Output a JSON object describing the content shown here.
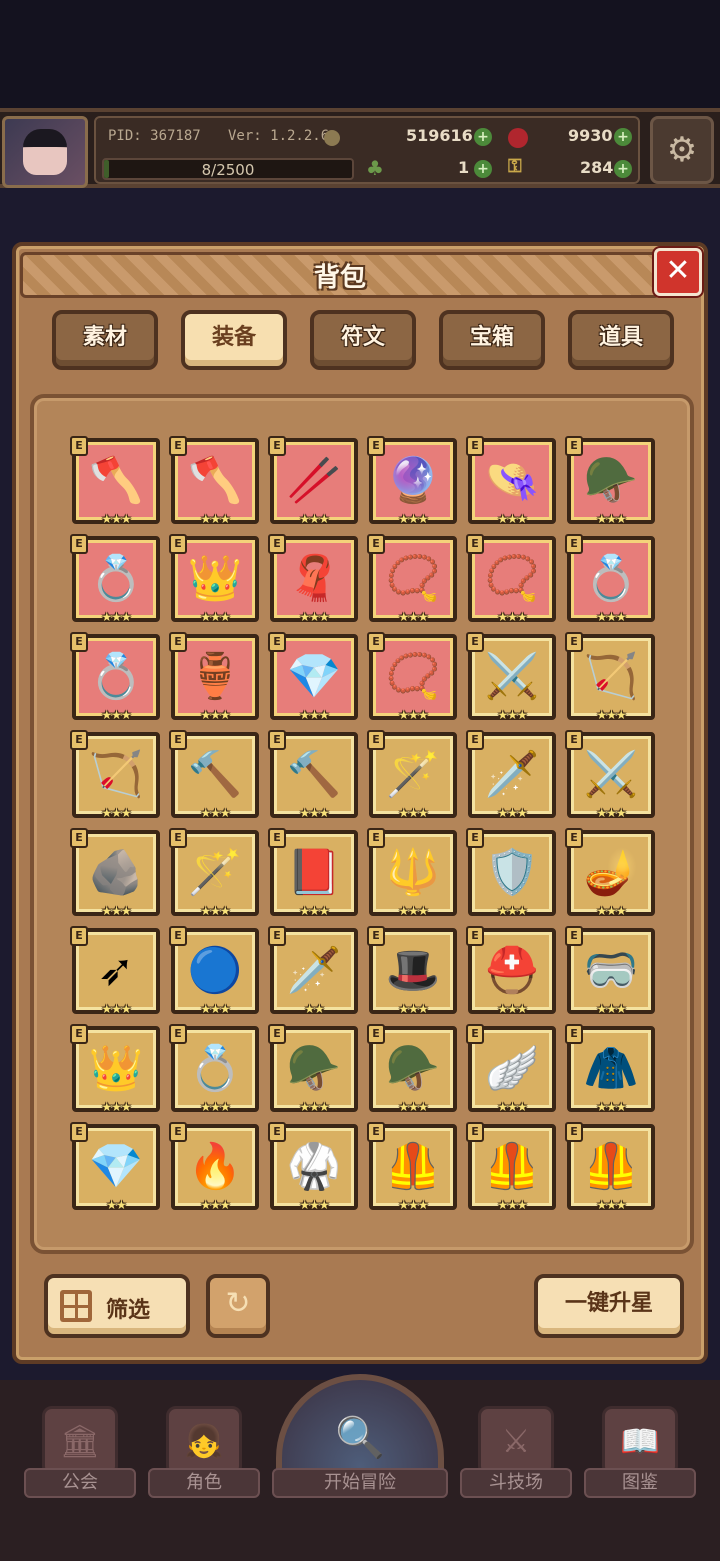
{
  "header": {
    "pid": "PID: 367187",
    "version": "Ver: 1.2.2.6",
    "exp": "8/2500",
    "gold": "519616",
    "gems": "9930",
    "clover": "1",
    "keys": "284",
    "settings_icon": "gear-icon"
  },
  "bag": {
    "title": "背包",
    "close_icon": "close-icon",
    "tabs": [
      {
        "label": "素材",
        "active": false
      },
      {
        "label": "装备",
        "active": true
      },
      {
        "label": "符文",
        "active": false
      },
      {
        "label": "宝箱",
        "active": false
      },
      {
        "label": "道具",
        "active": false
      }
    ],
    "badge": "E",
    "items": [
      {
        "icon": "double-axe-icon",
        "glyph": "🪓",
        "bg": "red",
        "stars": 3
      },
      {
        "icon": "battle-axe-icon",
        "glyph": "🪓",
        "bg": "red",
        "stars": 3
      },
      {
        "icon": "staff-icon",
        "glyph": "🥢",
        "bg": "red",
        "stars": 3
      },
      {
        "icon": "dark-orb-icon",
        "glyph": "🔮",
        "bg": "red",
        "stars": 3
      },
      {
        "icon": "straw-hat-icon",
        "glyph": "👒",
        "bg": "red",
        "stars": 3
      },
      {
        "icon": "crystal-helm-icon",
        "glyph": "🪖",
        "bg": "red",
        "stars": 3
      },
      {
        "icon": "fire-ring-icon",
        "glyph": "💍",
        "bg": "red",
        "stars": 3
      },
      {
        "icon": "horned-crown-icon",
        "glyph": "👑",
        "bg": "red",
        "stars": 3
      },
      {
        "icon": "red-cloak-icon",
        "glyph": "🧣",
        "bg": "red",
        "stars": 3
      },
      {
        "icon": "gold-amulet-icon",
        "glyph": "📿",
        "bg": "red",
        "stars": 3
      },
      {
        "icon": "pendant-icon",
        "glyph": "📿",
        "bg": "red",
        "stars": 3
      },
      {
        "icon": "jewel-ring-icon",
        "glyph": "💍",
        "bg": "red",
        "stars": 3
      },
      {
        "icon": "gold-ring-icon",
        "glyph": "💍",
        "bg": "red",
        "stars": 3
      },
      {
        "icon": "vase-icon",
        "glyph": "🏺",
        "bg": "red",
        "stars": 3
      },
      {
        "icon": "gem-brooch-icon",
        "glyph": "💎",
        "bg": "red",
        "stars": 3
      },
      {
        "icon": "silver-necklace-icon",
        "glyph": "📿",
        "bg": "red",
        "stars": 3
      },
      {
        "icon": "crossed-swords-icon",
        "glyph": "⚔️",
        "bg": "gold",
        "stars": 3
      },
      {
        "icon": "bow-icon",
        "glyph": "🏹",
        "bg": "gold",
        "stars": 3
      },
      {
        "icon": "crossbow-icon",
        "glyph": "🏹",
        "bg": "gold",
        "stars": 3
      },
      {
        "icon": "mace-icon",
        "glyph": "🔨",
        "bg": "gold",
        "stars": 3
      },
      {
        "icon": "war-hammer-icon",
        "glyph": "🔨",
        "bg": "gold",
        "stars": 3
      },
      {
        "icon": "golden-scepter-icon",
        "glyph": "🪄",
        "bg": "gold",
        "stars": 3
      },
      {
        "icon": "rapier-icon",
        "glyph": "🗡️",
        "bg": "gold",
        "stars": 3
      },
      {
        "icon": "twin-daggers-icon",
        "glyph": "⚔️",
        "bg": "gold",
        "stars": 3
      },
      {
        "icon": "stone-orb-icon",
        "glyph": "🪨",
        "bg": "gold",
        "stars": 3
      },
      {
        "icon": "wand-icon",
        "glyph": "🪄",
        "bg": "gold",
        "stars": 3
      },
      {
        "icon": "fire-tome-icon",
        "glyph": "📕",
        "bg": "gold",
        "stars": 3
      },
      {
        "icon": "halberd-icon",
        "glyph": "🔱",
        "bg": "gold",
        "stars": 3
      },
      {
        "icon": "blue-shield-icon",
        "glyph": "🛡️",
        "bg": "gold",
        "stars": 3
      },
      {
        "icon": "magic-lamp-icon",
        "glyph": "🪔",
        "bg": "gold",
        "stars": 3
      },
      {
        "icon": "arrow-icon",
        "glyph": "➶",
        "bg": "gold",
        "stars": 3
      },
      {
        "icon": "water-orb-icon",
        "glyph": "🔵",
        "bg": "gold",
        "stars": 3
      },
      {
        "icon": "short-sword-icon",
        "glyph": "🗡️",
        "bg": "gold",
        "stars": 2
      },
      {
        "icon": "top-hat-icon",
        "glyph": "🎩",
        "bg": "gold",
        "stars": 3
      },
      {
        "icon": "dark-helm-icon",
        "glyph": "⛑️",
        "bg": "gold",
        "stars": 3
      },
      {
        "icon": "goggles-icon",
        "glyph": "🥽",
        "bg": "gold",
        "stars": 3
      },
      {
        "icon": "jeweled-circlet-icon",
        "glyph": "👑",
        "bg": "gold",
        "stars": 3
      },
      {
        "icon": "gold-band-icon",
        "glyph": "💍",
        "bg": "gold",
        "stars": 3
      },
      {
        "icon": "knight-helm-icon",
        "glyph": "🪖",
        "bg": "gold",
        "stars": 3
      },
      {
        "icon": "bronze-helm-icon",
        "glyph": "🪖",
        "bg": "gold",
        "stars": 3
      },
      {
        "icon": "winged-helm-icon",
        "glyph": "🪽",
        "bg": "gold",
        "stars": 3
      },
      {
        "icon": "red-hood-icon",
        "glyph": "🧥",
        "bg": "gold",
        "stars": 3
      },
      {
        "icon": "crystal-armor-icon",
        "glyph": "💎",
        "bg": "gold",
        "stars": 2
      },
      {
        "icon": "flame-armor-icon",
        "glyph": "🔥",
        "bg": "gold",
        "stars": 3
      },
      {
        "icon": "gold-robe-icon",
        "glyph": "🥋",
        "bg": "gold",
        "stars": 3
      },
      {
        "icon": "dark-plate-icon",
        "glyph": "🦺",
        "bg": "gold",
        "stars": 3
      },
      {
        "icon": "olive-armor-icon",
        "glyph": "🦺",
        "bg": "gold",
        "stars": 3
      },
      {
        "icon": "jade-armor-icon",
        "glyph": "🦺",
        "bg": "gold",
        "stars": 3
      }
    ],
    "filter_label": "筛选",
    "refresh_icon": "refresh-icon",
    "star_up_label": "一键升星"
  },
  "nav": [
    {
      "label": "公会",
      "icon": "guild-icon",
      "glyph": "🏛"
    },
    {
      "label": "角色",
      "icon": "character-icon",
      "glyph": "👧"
    },
    {
      "label": "开始冒险",
      "icon": "adventure-icon",
      "glyph": "🔍"
    },
    {
      "label": "斗技场",
      "icon": "arena-icon",
      "glyph": "⚔"
    },
    {
      "label": "图鉴",
      "icon": "codex-icon",
      "glyph": "📖"
    }
  ],
  "colors": {
    "red_slot": "#e77d7a",
    "gold_slot": "#d9b062",
    "close_button": "#d0342c",
    "active_tab": "#f7dfb0"
  }
}
